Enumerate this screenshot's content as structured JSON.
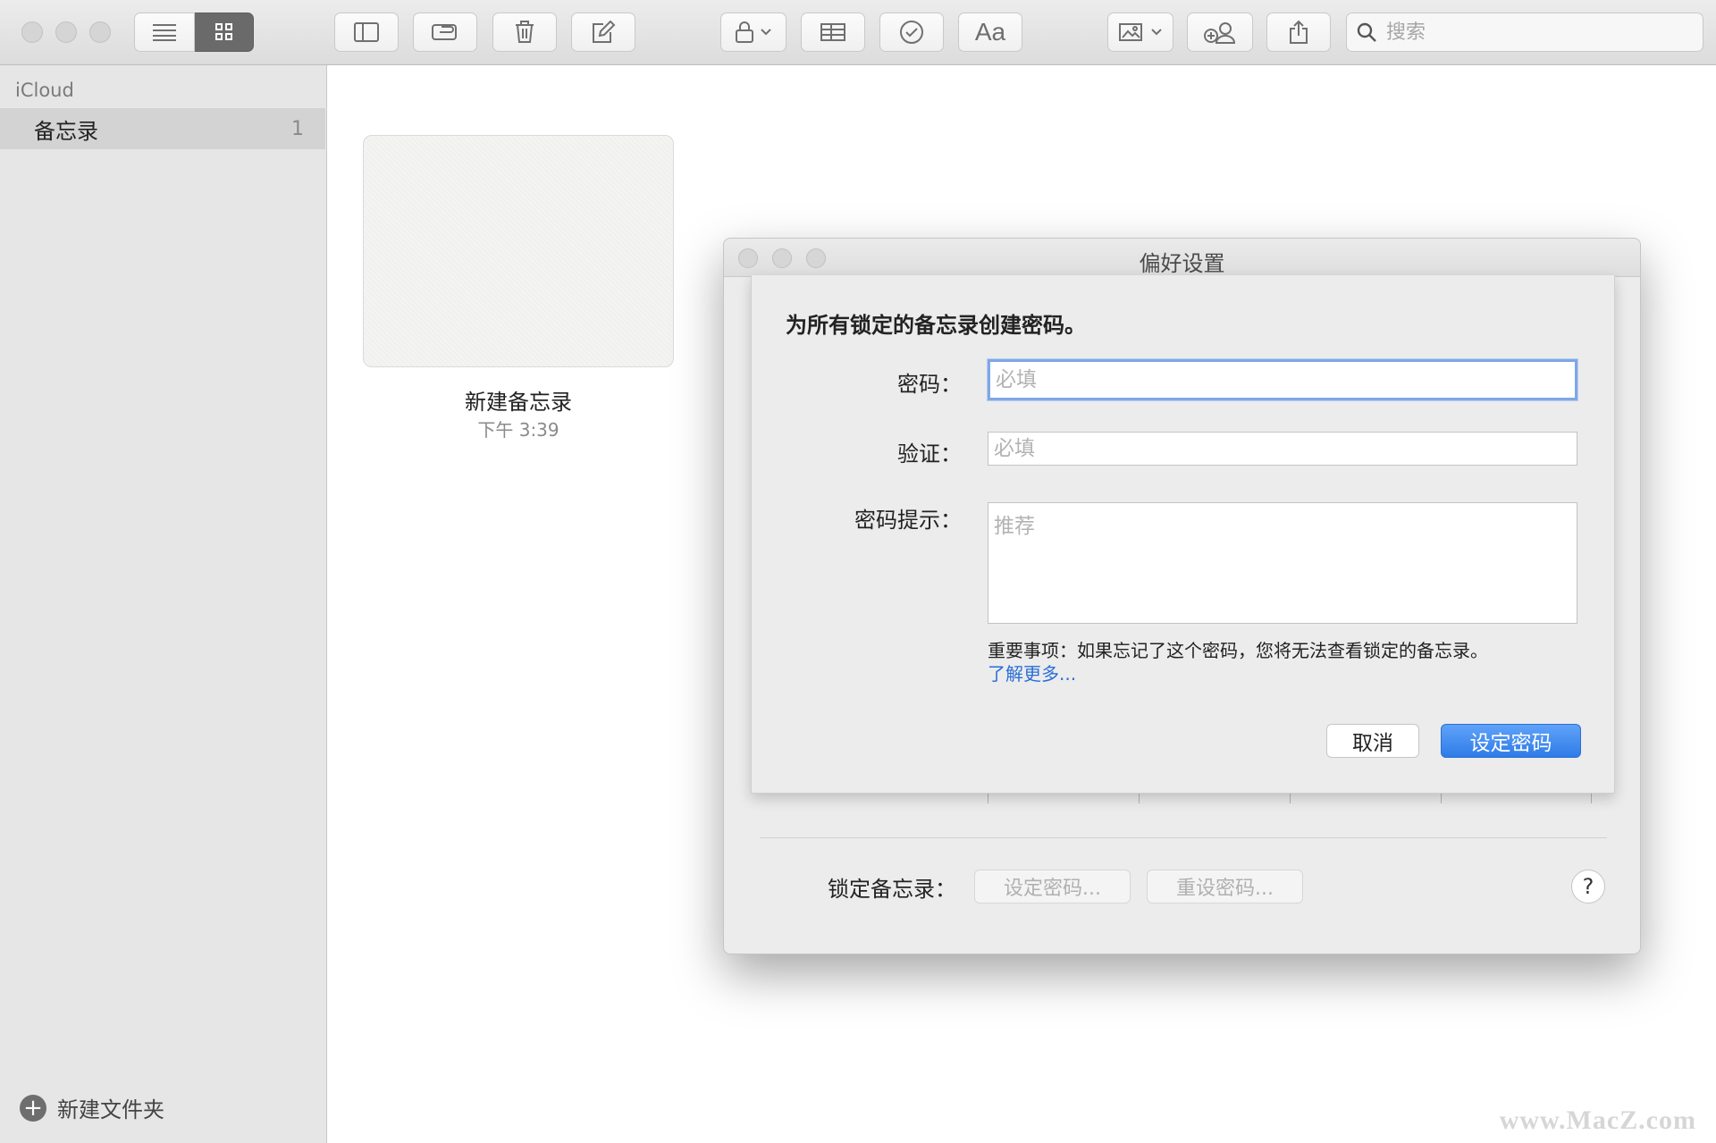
{
  "toolbar": {
    "search_placeholder": "搜索",
    "format_label": "Aa"
  },
  "sidebar": {
    "section_title": "iCloud",
    "items": [
      {
        "label": "备忘录",
        "count": "1"
      }
    ],
    "new_folder_label": "新建文件夹"
  },
  "note": {
    "title": "新建备忘录",
    "time": "下午 3:39"
  },
  "preferences": {
    "window_title": "偏好设置",
    "lock_label": "锁定备忘录：",
    "set_password_label": "设定密码...",
    "reset_password_label": "重设密码...",
    "help_label": "?"
  },
  "sheet": {
    "heading": "为所有锁定的备忘录创建密码。",
    "password_label": "密码：",
    "password_placeholder": "必填",
    "verify_label": "验证：",
    "verify_placeholder": "必填",
    "hint_label": "密码提示：",
    "hint_placeholder": "推荐",
    "warning": "重要事项：如果忘记了这个密码，您将无法查看锁定的备忘录。",
    "learn_more": "了解更多...",
    "cancel_label": "取消",
    "confirm_label": "设定密码"
  },
  "watermark": "www.MacZ.com",
  "colors": {
    "accent": "#2f7ce8",
    "link": "#2a6ed8",
    "focus_ring": "#7fa7e6"
  }
}
